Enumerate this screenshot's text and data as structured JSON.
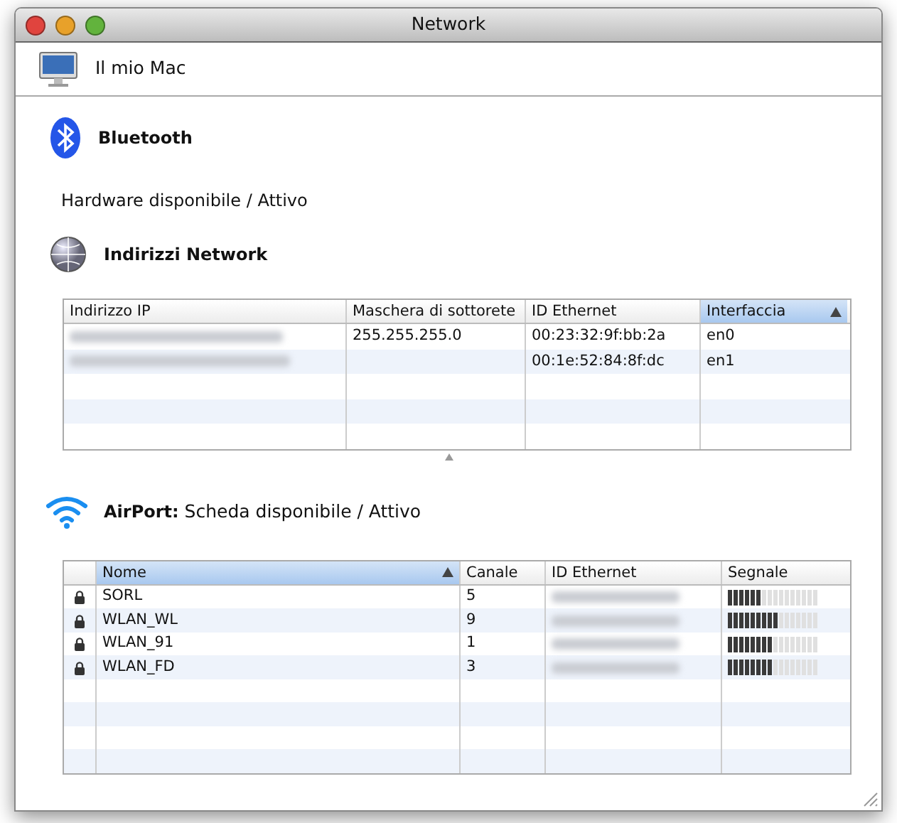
{
  "window": {
    "title": "Network"
  },
  "device": {
    "label": "Il mio Mac"
  },
  "bluetooth": {
    "title": "Bluetooth",
    "status": "Hardware disponibile / Attivo"
  },
  "addresses": {
    "title": "Indirizzi Network",
    "columns": [
      {
        "label": "Indirizzo IP",
        "sorted": false
      },
      {
        "label": "Maschera di sottorete",
        "sorted": false
      },
      {
        "label": "ID Ethernet",
        "sorted": false
      },
      {
        "label": "Interfaccia",
        "sorted": true
      }
    ],
    "rows": [
      {
        "ip_blurred": true,
        "mask": "255.255.255.0",
        "ethernet": "00:23:32:9f:bb:2a",
        "interface": "en0"
      },
      {
        "ip_blurred": true,
        "mask": "",
        "ethernet": "00:1e:52:84:8f:dc",
        "interface": "en1"
      }
    ]
  },
  "airport": {
    "title": "AirPort:",
    "status": "Scheda disponibile / Attivo",
    "columns": [
      {
        "label": "Nome",
        "sorted": true
      },
      {
        "label": "Canale",
        "sorted": false
      },
      {
        "label": "ID Ethernet",
        "sorted": false
      },
      {
        "label": "Segnale",
        "sorted": false
      }
    ],
    "rows": [
      {
        "locked": true,
        "name": "SORL",
        "channel": "5",
        "ethernet_blurred": true,
        "level": 0.375
      },
      {
        "locked": true,
        "name": "WLAN_WL",
        "channel": "9",
        "ethernet_blurred": true,
        "level": 0.5625
      },
      {
        "locked": true,
        "name": "WLAN_91",
        "channel": "1",
        "ethernet_blurred": true,
        "level": 0.5
      },
      {
        "locked": true,
        "name": "WLAN_FD",
        "channel": "3",
        "ethernet_blurred": true,
        "level": 0.5
      }
    ]
  }
}
